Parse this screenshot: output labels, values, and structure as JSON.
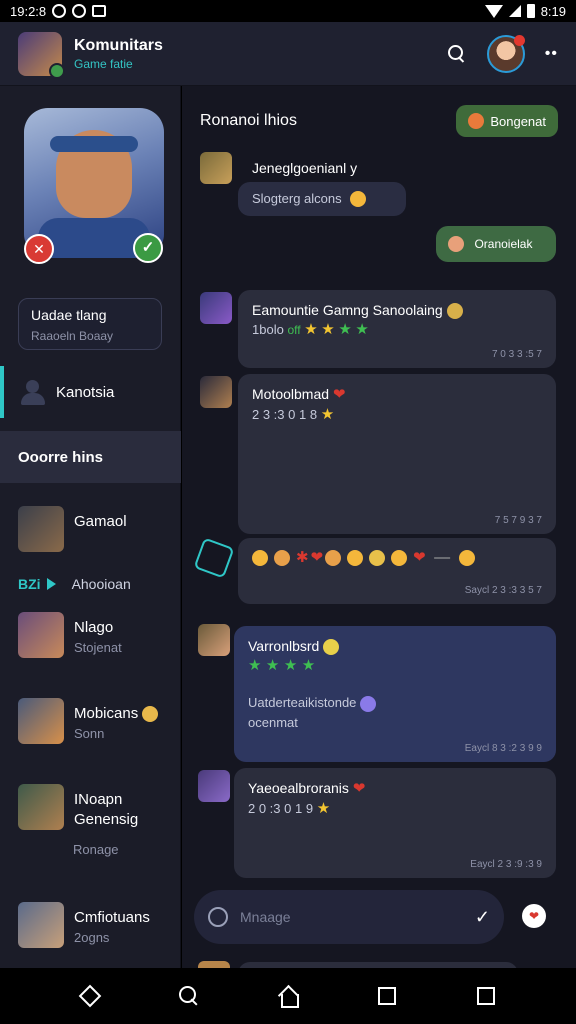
{
  "status_bar": {
    "time_left": "19:2:8",
    "time_right": "8:19"
  },
  "header": {
    "title": "Komunitars",
    "subtitle": "Game fatie"
  },
  "sidebar": {
    "status_box": {
      "line1": "Uadae tlang",
      "line2": "Raaoeln Boaay"
    },
    "profile_nav_label": "Kanotsia",
    "active_section": "Ooorre hins",
    "friends": [
      {
        "name": "Gamaol",
        "sub": ""
      },
      {
        "name": "Nlago",
        "sub": "Stojenat"
      },
      {
        "name": "Mobicans",
        "sub": "Sonn"
      },
      {
        "name": "INoapn Genensig",
        "sub": ""
      },
      {
        "name": "Cmfiotuans",
        "sub": "2ogns"
      }
    ],
    "sub_row": {
      "code": "BZi",
      "text": "Ahooioan"
    },
    "lone_sub": "Ronage"
  },
  "chat": {
    "title": "Ronanoi lhios",
    "header_button": "Bongenat",
    "messages": [
      {
        "line1": "Jeneglgoenianl y",
        "line2": "Slogterg alcons"
      },
      {
        "text": "Oranoielak"
      },
      {
        "line1": "Eamountie Gamng Sanoolaing",
        "line2": "1bolo",
        "line2_green": "off",
        "time": "7 0 3 3 :5 7"
      },
      {
        "line1": "Motoolbmad",
        "line2": "2 3 :3 0 1 8",
        "time": "7 5 7 9 3 7"
      },
      {
        "time": "Saycl 2 3 :3 3 5 7"
      },
      {
        "line1": "Varronlbsrd",
        "line2": "Uatderteaikistonde",
        "line3": "ocenmat",
        "time": "Eaycl 8 3 :2 3 9 9"
      },
      {
        "line1": "Yaeoealbroranis",
        "line2": "2 0 :3 0 1 9",
        "time": "Eaycl 2 3 :9 :3 9"
      }
    ]
  },
  "composer": {
    "placeholder": "Mnaage",
    "value": ""
  },
  "colors": {
    "accent": "#2fc7c7",
    "green": "#3f9c4c",
    "danger": "#d93a34",
    "background": "#151621"
  }
}
